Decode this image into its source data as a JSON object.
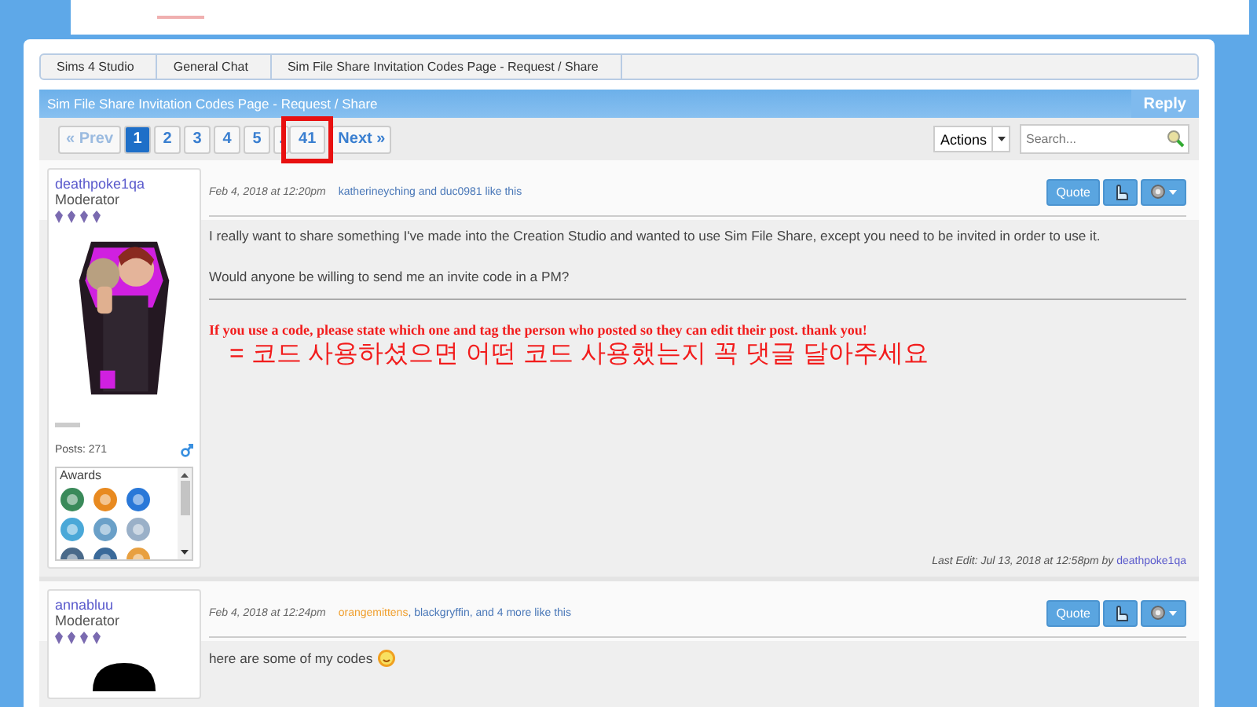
{
  "breadcrumbs": [
    {
      "label": "Sims 4 Studio"
    },
    {
      "label": "General Chat"
    },
    {
      "label": "Sim File Share Invitation Codes Page - Request / Share"
    }
  ],
  "thread": {
    "title": "Sim File Share Invitation Codes Page - Request / Share",
    "reply_button": "Reply"
  },
  "pagination": {
    "prev": "« Prev",
    "pages": [
      {
        "label": "1",
        "selected": true
      },
      {
        "label": "2",
        "selected": false
      },
      {
        "label": "3",
        "selected": false
      },
      {
        "label": "4",
        "selected": false
      },
      {
        "label": "5",
        "selected": false
      }
    ],
    "ellipsis": ".",
    "last": {
      "label": "41",
      "selected": false,
      "highlighted": true
    },
    "next": "Next »"
  },
  "actions_button": "Actions",
  "search": {
    "placeholder": "Search..."
  },
  "posts": [
    {
      "author": "deathpoke1qa",
      "role": "Moderator",
      "avatar": {
        "kind": "picture"
      },
      "posts_count": "Posts: 271",
      "awards_title": "Awards",
      "date": "Feb 4, 2018 at 12:20pm",
      "likes": [
        {
          "text": "katherineyching and duc0981 like this",
          "color": "#4a78b8"
        }
      ],
      "quote_button": "Quote",
      "body": [
        {
          "kind": "text",
          "text": "I really want to share something I've made into the Creation Studio and wanted to use Sim File Share, except you need to be invited in order to use it."
        },
        {
          "kind": "text",
          "text": "Would anyone be willing to send me an invite code in a PM?"
        },
        {
          "kind": "rule"
        },
        {
          "kind": "alert",
          "text": "If you use a code, please state which one and tag the person who posted so they can edit their post. thank you!"
        },
        {
          "kind": "big",
          "text": "= 코드 사용하셨으면 어떤 코드 사용했는지 꼭 댓글 달아주세요"
        }
      ],
      "last_edit": {
        "text": "Last Edit: Jul 13, 2018 at 12:58pm by",
        "user": "deathpoke1qa"
      }
    },
    {
      "author": "annabluu",
      "role": "Moderator",
      "avatar": {
        "kind": "silhouette"
      },
      "date": "Feb 4, 2018 at 12:24pm",
      "likes": [
        {
          "text": "orangemittens",
          "color": "#f0a030"
        },
        {
          "text": ", blackgryffin, and 4 more like this",
          "color": "#4a78b8"
        }
      ],
      "quote_button": "Quote",
      "body": [
        {
          "kind": "smiley",
          "text": "here are some of my codes"
        }
      ]
    }
  ]
}
